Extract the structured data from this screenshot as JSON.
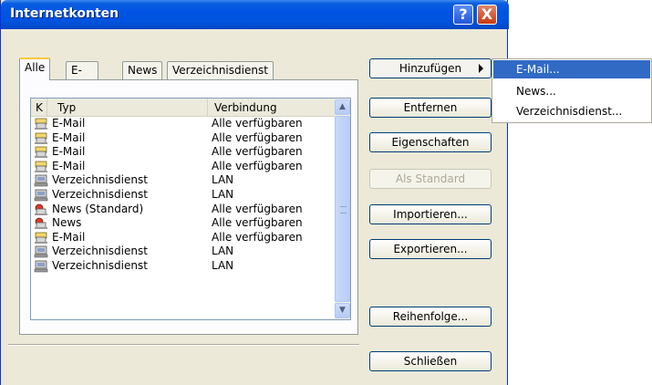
{
  "window": {
    "title": "Internetkonten"
  },
  "titlebar_buttons": {
    "help": "?",
    "close": "X"
  },
  "tabs": [
    "Alle",
    "E-Mail",
    "News",
    "Verzeichnisdienst"
  ],
  "list": {
    "columns": [
      "K",
      "Typ",
      "Verbindung"
    ],
    "rows": [
      {
        "icon": "mail-account-icon",
        "typ": "E-Mail",
        "verbindung": "Alle verfügbaren"
      },
      {
        "icon": "mail-account-icon",
        "typ": "E-Mail",
        "verbindung": "Alle verfügbaren"
      },
      {
        "icon": "mail-account-icon",
        "typ": "E-Mail",
        "verbindung": "Alle verfügbaren"
      },
      {
        "icon": "mail-account-icon",
        "typ": "E-Mail",
        "verbindung": "Alle verfügbaren"
      },
      {
        "icon": "directory-service-icon",
        "typ": "Verzeichnisdienst",
        "verbindung": "LAN"
      },
      {
        "icon": "directory-service-icon",
        "typ": "Verzeichnisdienst",
        "verbindung": "LAN"
      },
      {
        "icon": "news-account-icon",
        "typ": "News (Standard)",
        "verbindung": "Alle verfügbaren"
      },
      {
        "icon": "news-account-icon",
        "typ": "News",
        "verbindung": "Alle verfügbaren"
      },
      {
        "icon": "mail-account-icon",
        "typ": "E-Mail",
        "verbindung": "Alle verfügbaren"
      },
      {
        "icon": "directory-service-icon",
        "typ": "Verzeichnisdienst",
        "verbindung": "LAN"
      },
      {
        "icon": "directory-service-icon",
        "typ": "Verzeichnisdienst",
        "verbindung": "LAN"
      }
    ]
  },
  "buttons": {
    "add": "Hinzufügen",
    "remove": "Entfernen",
    "properties": "Eigenschaften",
    "set_default": "Als Standard",
    "import": "Importieren...",
    "export": "Exportieren...",
    "order": "Reihenfolge...",
    "close": "Schließen"
  },
  "add_menu": {
    "items": [
      "E-Mail...",
      "News...",
      "Verzeichnisdienst..."
    ],
    "selected_index": 0
  },
  "colors": {
    "titlebar": "#0054e3",
    "menu_highlight": "#316ac5",
    "dialog_face": "#ece9d8"
  }
}
